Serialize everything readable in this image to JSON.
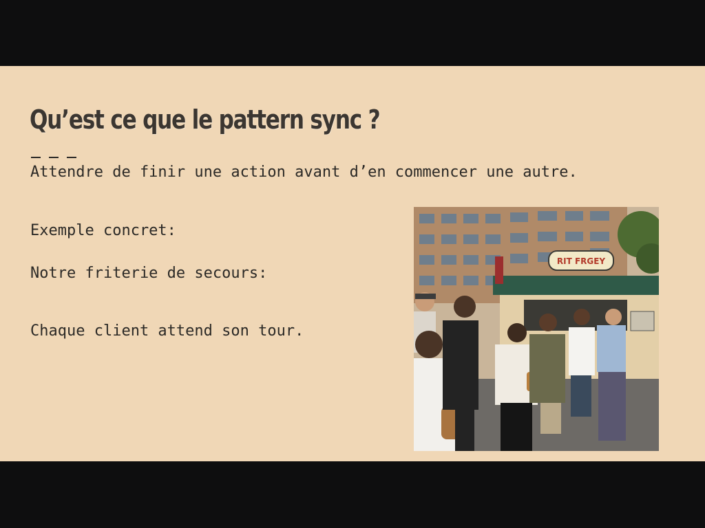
{
  "slide": {
    "title": "Qu’est ce que le pattern sync ?",
    "lead": "Attendre de finir une action avant d’en commencer une autre.",
    "example_label": "Exemple concret:",
    "friterie_label": "Notre friterie de secours:",
    "queue_label": "Chaque client attend son tour.",
    "photo": {
      "sign_text": "RIT FRGEY"
    }
  }
}
